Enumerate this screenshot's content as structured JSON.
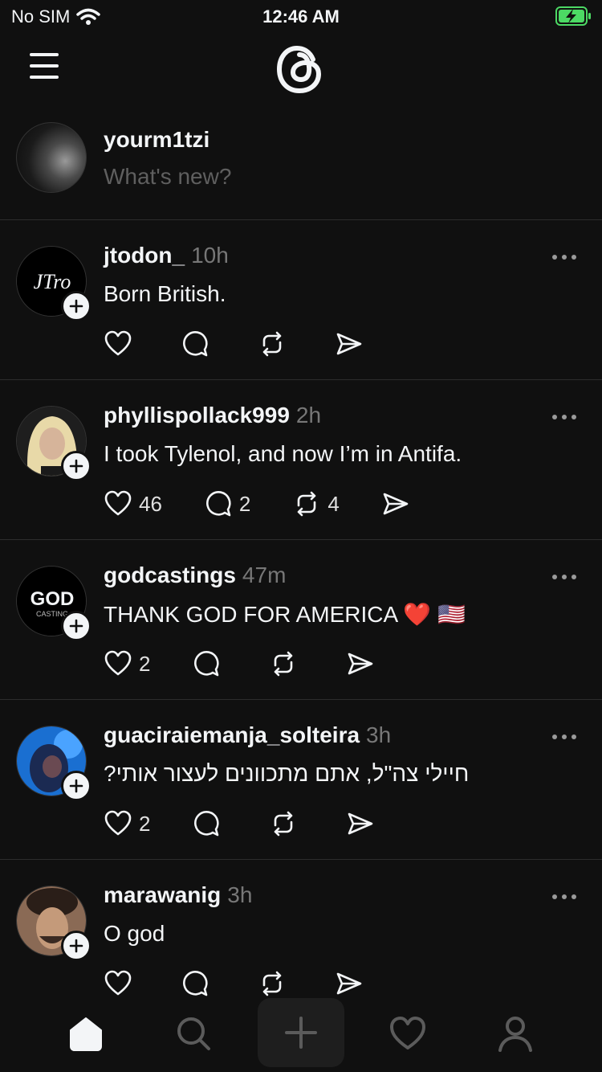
{
  "status_bar": {
    "carrier": "No SIM",
    "time": "12:46 AM"
  },
  "composer": {
    "username": "yourm1tzi",
    "placeholder": "What's new?"
  },
  "posts": [
    {
      "username": "jtodon_",
      "time": "10h",
      "text": "Born British.",
      "likes": "",
      "replies": "",
      "reposts": ""
    },
    {
      "username": "phyllispollack999",
      "time": "2h",
      "text": "I took Tylenol, and now I’m in Antifa.",
      "likes": "46",
      "replies": "2",
      "reposts": "4"
    },
    {
      "username": "godcastings",
      "time": "47m",
      "text": "THANK GOD FOR AMERICA ❤️ 🇺🇸",
      "likes": "2",
      "replies": "",
      "reposts": ""
    },
    {
      "username": "guaciraiemanja_solteira",
      "time": "3h",
      "text": "חיילי צה\"ל, אתם מתכוונים לעצור אותי?",
      "likes": "2",
      "replies": "",
      "reposts": ""
    },
    {
      "username": "marawanig",
      "time": "3h",
      "text": "O god",
      "likes": "",
      "replies": "",
      "reposts": ""
    }
  ],
  "colors": {
    "background": "#101010",
    "text": "#f3f5f7",
    "muted": "#777777",
    "divider": "#2d2d2d",
    "battery_green": "#4cd964"
  },
  "icons": [
    "menu-icon",
    "threads-logo",
    "heart-icon",
    "reply-icon",
    "repost-icon",
    "share-icon",
    "more-icon",
    "home-icon",
    "search-icon",
    "create-icon",
    "activity-icon",
    "profile-icon"
  ]
}
